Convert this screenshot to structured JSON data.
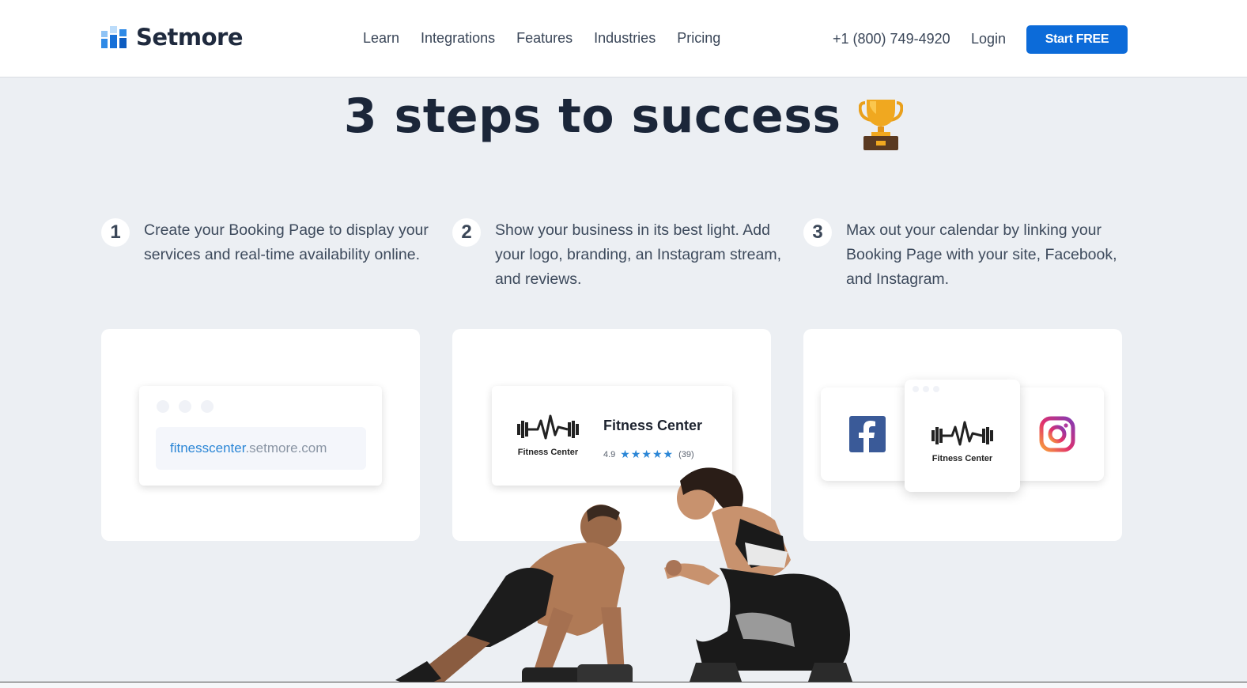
{
  "brand": {
    "name": "Setmore",
    "color": "#0c6bd9"
  },
  "nav": [
    "Learn",
    "Integrations",
    "Features",
    "Industries",
    "Pricing"
  ],
  "header": {
    "phone": "+1 (800) 749-4920",
    "login": "Login",
    "cta": "Start FREE"
  },
  "headline": "3 steps to success",
  "steps": [
    {
      "num": "1",
      "text": "Create your Booking Page to display your services and real-time availability online."
    },
    {
      "num": "2",
      "text": "Show your business in its best light. Add your logo, branding, an Instagram stream, and reviews."
    },
    {
      "num": "3",
      "text": "Max out your calendar by linking your Booking Page with your site, Facebook, and Instagram."
    }
  ],
  "card1": {
    "url_sub": "fitnesscenter",
    "url_domain": ".setmore.com"
  },
  "card2": {
    "logo_caption": "Fitness Center",
    "business_name": "Fitness Center",
    "rating": "4.9",
    "stars": "★★★★★",
    "reviews": "(39)"
  },
  "card3": {
    "logo_caption": "Fitness Center",
    "icons": [
      "facebook-icon",
      "instagram-icon"
    ]
  }
}
